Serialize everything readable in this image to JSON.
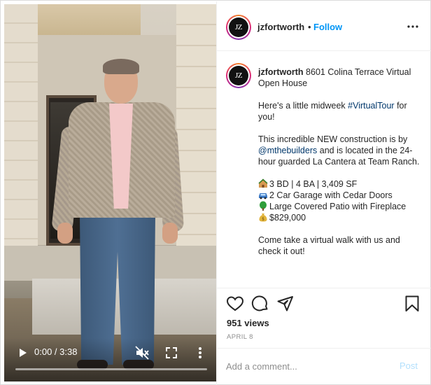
{
  "video": {
    "current_time": "0:00",
    "duration": "3:38",
    "time_display": "0:00 / 3:38",
    "progress": 0.0,
    "muted": true
  },
  "header": {
    "username": "jzfortworth",
    "separator": "•",
    "follow_label": "Follow",
    "avatar_text": "JZ"
  },
  "caption": {
    "username": "jzfortworth",
    "first_line": " 8601 Colina Terrace Virtual Open House",
    "p1_pre": "Here's a little midweek ",
    "p1_hashtag": "#VirtualTour",
    "p1_post": " for you!",
    "p2_pre": "This incredible NEW construction is by ",
    "p2_mention": "@mthebuilders",
    "p2_post": " and is located in the 24-hour guarded La Cantera at Team Ranch.",
    "bullet1": "3 BD | 4 BA | 3,409 SF",
    "bullet2": "2 Car Garage with Cedar Doors",
    "bullet3": "Large Covered Patio with Fireplace",
    "bullet4": "$829,000",
    "p4": "Come take a virtual walk with us and check it out!"
  },
  "engagement": {
    "views": "951 views",
    "date": "APRIL 8"
  },
  "comment": {
    "placeholder": "Add a comment...",
    "post_label": "Post"
  },
  "colors": {
    "link_blue": "#0095f6",
    "post_disabled": "#b2dffc",
    "muted_text": "#8e8e8e"
  },
  "icons": [
    "heart-icon",
    "comment-icon",
    "share-icon",
    "bookmark-icon",
    "more-icon",
    "play-icon",
    "mute-icon",
    "fullscreen-icon"
  ]
}
